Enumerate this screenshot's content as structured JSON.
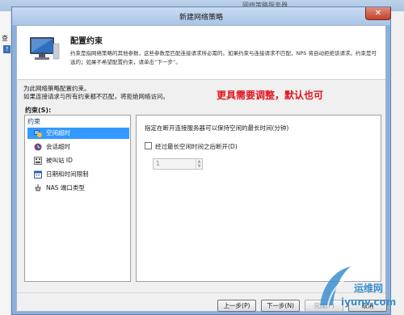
{
  "background_window": {
    "title": "网络策略服务器",
    "menu_char": "查",
    "help_char": "?"
  },
  "dialog": {
    "title": "新建网络策略",
    "close_glyph": "✕"
  },
  "header": {
    "title": "配置约束",
    "description": "约束是指网络策略的其他参数，这些参数是匹配连接请求所必需的。如果约束与连接请求不匹配，NPS 将自动拒绝该请求。约束是可选的；如果不希望配置约束，请单击“下一步”。"
  },
  "intro": {
    "line1": "为此网络策略配置约束。",
    "line2": "如果连接请求与所有约束都不匹配，将拒绝网络访问。"
  },
  "annotation": "更具需要调整，默认也可",
  "constraints_label": "约束(S):",
  "constraints_list": {
    "header": "约束",
    "items": [
      {
        "label": "空闲超时",
        "icon": "idle-timeout-icon",
        "selected": true
      },
      {
        "label": "会话超时",
        "icon": "session-timeout-icon",
        "selected": false
      },
      {
        "label": "被叫站 ID",
        "icon": "called-station-icon",
        "selected": false
      },
      {
        "label": "日期和时间限制",
        "icon": "calendar-icon",
        "selected": false
      },
      {
        "label": "NAS 端口类型",
        "icon": "nas-port-icon",
        "selected": false
      }
    ]
  },
  "idle_panel": {
    "label": "指定在断开连接服务器可以保持空闲的最长时间(分钟)",
    "checkbox_label": "经过最长空闲时间之后断开(D)",
    "checkbox_checked": false,
    "minutes_value": "1"
  },
  "buttons": {
    "prev": "上一步(P)",
    "next": "下一步(N)",
    "finish": "完成(F)",
    "cancel": "取消"
  },
  "watermark": {
    "text1": "运维网",
    "text2": "iyunv.com"
  },
  "colors": {
    "selection": "#3399ff",
    "annotation": "#e0141e",
    "titlebar": "#a8c5e6"
  }
}
